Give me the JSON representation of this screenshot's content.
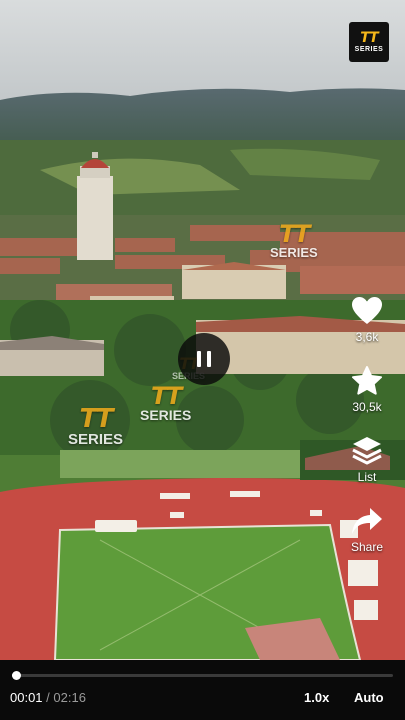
{
  "brand": {
    "logo_mark": "TT",
    "logo_word": "SERIES"
  },
  "watermarks": [
    {
      "mark": "TT",
      "word": "SERIES"
    },
    {
      "mark": "TT",
      "word": "SERIES"
    },
    {
      "mark": "TT",
      "word": "SERIES"
    },
    {
      "mark": "TT",
      "word": "SERIES"
    }
  ],
  "player": {
    "state_icon": "pause-icon",
    "current_time": "00:01",
    "separator": "/",
    "duration": "02:16",
    "progress_fraction": 0.01,
    "speed": "1.0x",
    "quality": "Auto"
  },
  "actions": [
    {
      "icon": "heart-icon",
      "label": "3,6k"
    },
    {
      "icon": "star-icon",
      "label": "30,5k"
    },
    {
      "icon": "list-icon",
      "label": "List"
    },
    {
      "icon": "share-icon",
      "label": "Share"
    }
  ],
  "colors": {
    "brand_gold": "#f2ab1b",
    "track_red": "#c64b43",
    "field_green": "#5e9c3a"
  }
}
